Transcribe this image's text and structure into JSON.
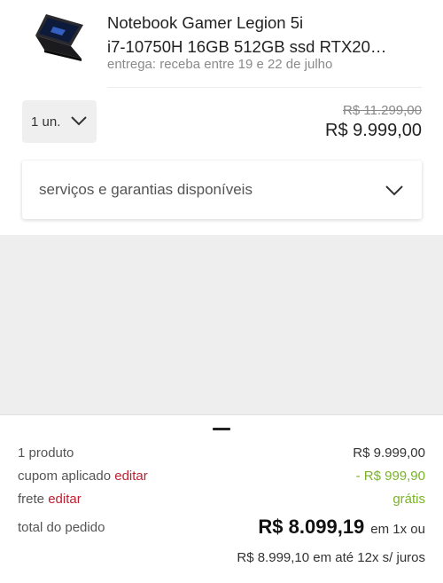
{
  "product": {
    "title_line1": "Notebook Gamer Legion 5i",
    "title_line2": "i7-10750H 16GB 512GB ssd RTX20…",
    "delivery": "entrega: receba entre 19 e 22 de julho",
    "quantity": "1 un.",
    "old_price": "R$ 11.299,00",
    "price": "R$ 9.999,00",
    "image_icon": "laptop-icon"
  },
  "services": {
    "label": "serviços e garantias disponíveis"
  },
  "summary": {
    "products_label": "1 produto",
    "products_value": "R$ 9.999,00",
    "coupon_label": "cupom aplicado",
    "coupon_edit": "editar",
    "coupon_value": "- R$ 999,90",
    "shipping_label": "frete",
    "shipping_edit": "editar",
    "shipping_value": "grátis",
    "total_label": "total do pedido",
    "total_value": "R$ 8.099,19",
    "total_suffix": "em 1x ou",
    "installments": "R$ 8.999,10 em até 12x s/ juros"
  },
  "colors": {
    "link": "#c01f2f",
    "discount": "#7ab328",
    "background_gray": "#eeeeee"
  }
}
